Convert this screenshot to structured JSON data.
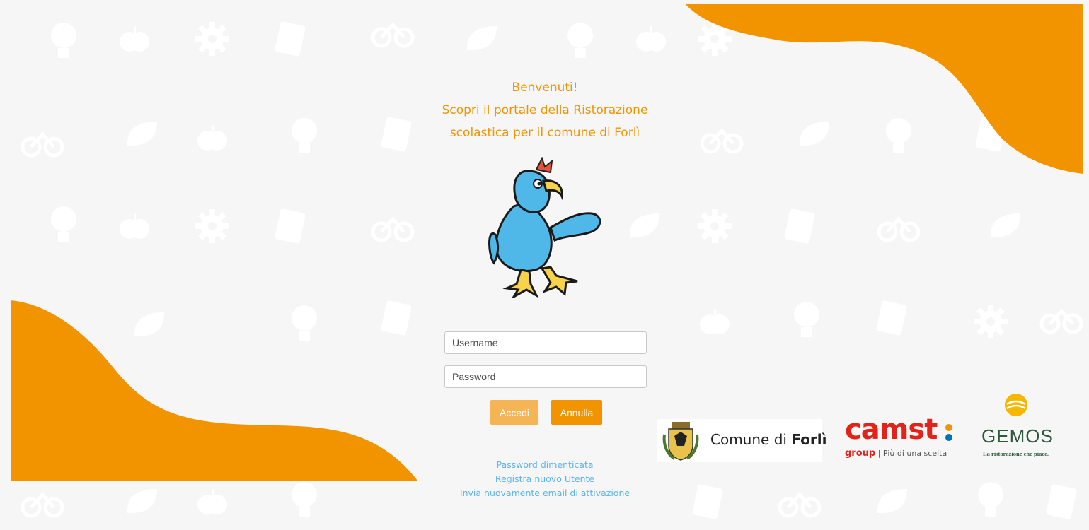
{
  "welcome": {
    "line1": "Benvenuti!",
    "line2": "Scopri il portale della Ristorazione",
    "line3": "scolastica per il comune di Forlì"
  },
  "login": {
    "username_placeholder": "Username",
    "password_placeholder": "Password",
    "accedi_label": "Accedi",
    "annulla_label": "Annulla"
  },
  "links": {
    "forgot_password": "Password dimenticata",
    "register": "Registra nuovo Utente",
    "resend_activation": "Invia nuovamente email di attivazione"
  },
  "logos": {
    "comune_prefix": "Comune di",
    "comune_city": "Forlì",
    "camst_word": "camst",
    "camst_group": "group",
    "camst_tagline": "| Più di una scelta",
    "gemos_word": "GEMOS",
    "gemos_tagline": "La ristorazione che piace."
  },
  "colors": {
    "accent": "#f29400",
    "accent_light": "#f5b555",
    "link": "#5bb3e8",
    "background": "#f6f6f6"
  },
  "icons": [
    "mascot-bird-icon",
    "comune-crest-icon",
    "gemos-sun-icon"
  ]
}
